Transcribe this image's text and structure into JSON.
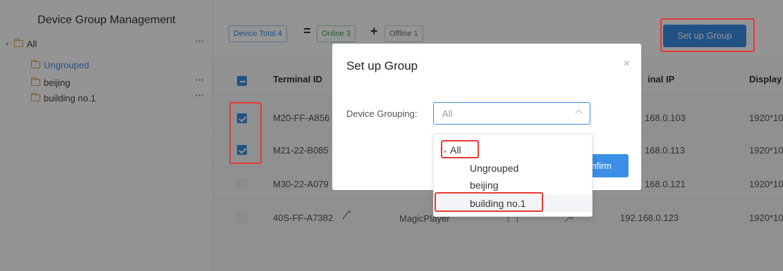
{
  "sidebar": {
    "title": "Device Group Management",
    "tree": [
      {
        "label": "All",
        "more": "•••"
      },
      {
        "label": "Ungrouped",
        "more": ""
      },
      {
        "label": "beijing",
        "more": "•••"
      },
      {
        "label": "building no.1",
        "more": "•••"
      }
    ]
  },
  "stats": {
    "total": "Device Total 4",
    "eq": "=",
    "online": "Online 3",
    "plus": "+",
    "offline": "Offline 1"
  },
  "toolbar": {
    "setup_group": "Set up Group"
  },
  "table": {
    "columns": [
      "Terminal ID",
      "inal IP",
      "Display"
    ],
    "rows": [
      {
        "id": "M20-FF-A856",
        "ip": "168.0.103",
        "display": "1920*10",
        "checked": true
      },
      {
        "id": "M21-22-B085",
        "ip": "168.0.113",
        "display": "1920*10",
        "checked": true
      },
      {
        "id": "M30-22-A079",
        "ip": "168.0.121",
        "display": "1920*10",
        "checked": false
      },
      {
        "id": "40S-FF-A7382",
        "player": "MagicPlayer",
        "ip": "192.168.0.123",
        "display": "1920*10",
        "checked": false
      }
    ]
  },
  "modal": {
    "title": "Set up Group",
    "close": "×",
    "field_label": "Device Grouping:",
    "select_value": "All",
    "confirm": "onfirm"
  },
  "dropdown": {
    "items": [
      {
        "label": "All",
        "caret": "▾"
      },
      {
        "label": "Ungrouped"
      },
      {
        "label": "beijing"
      },
      {
        "label": "building no.1"
      }
    ]
  },
  "colors": {
    "accent": "#3a8ee6",
    "highlight": "#e53935",
    "online": "#47a447"
  },
  "icons": [
    "folder-icon",
    "chevron-down-icon",
    "more-icon",
    "close-icon",
    "checkbox-icon",
    "link-icon"
  ]
}
